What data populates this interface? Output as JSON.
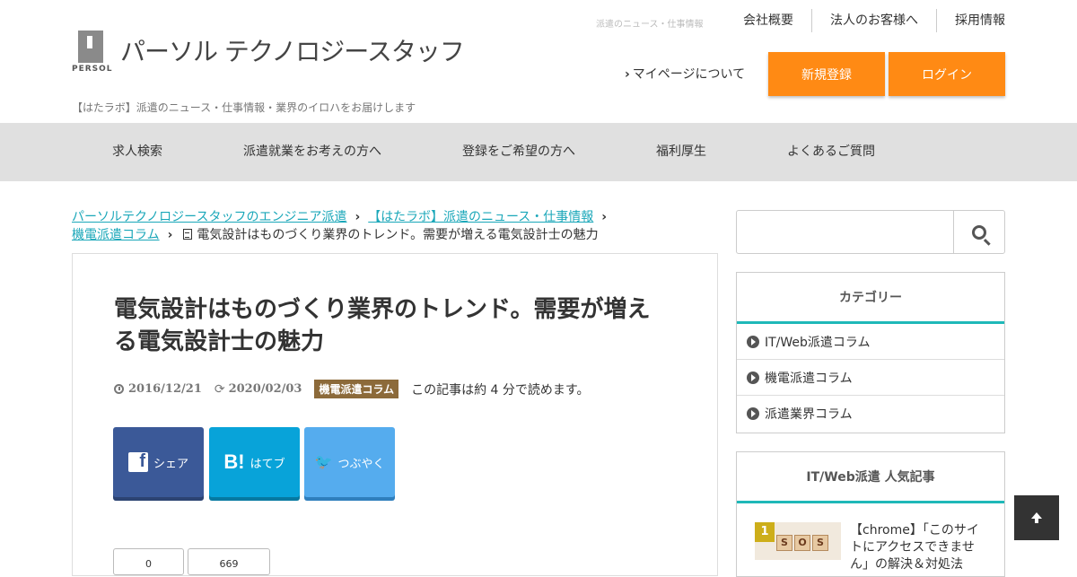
{
  "header": {
    "logo_text": "パーソル テクノロジースタッフ",
    "logo_sub": "PERSOL",
    "tagline": "【はたラボ】派遣のニュース・仕事情報・業界のイロハをお届けします",
    "top_small": "派遣のニュース・仕事情報",
    "top_links": [
      "会社概要",
      "法人のお客様へ",
      "採用情報"
    ],
    "mypage": "マイページについて",
    "register_button": "新規登録",
    "login_button": "ログイン",
    "accent_color": "#ff8a14"
  },
  "nav": {
    "items": [
      "求人検索",
      "派遣就業をお考えの方へ",
      "登録をご希望の方へ",
      "福利厚生",
      "よくあるご質問"
    ]
  },
  "breadcrumb": {
    "items": [
      "パーソルテクノロジースタッフのエンジニア派遣",
      "【はたラボ】派遣のニュース・仕事情報",
      "機電派遣コラム"
    ],
    "current": "電気設計はものづくり業界のトレンド。需要が増える電気設計士の魅力"
  },
  "article": {
    "title": "電気設計はものづくり業界のトレンド。需要が増える電気設計士の魅力",
    "published": "2016/12/21",
    "updated": "2020/02/03",
    "category": "機電派遣コラム",
    "read_time": "この記事は約 4 分で読めます。",
    "share": {
      "facebook": "シェア",
      "hatena": "はてブ",
      "twitter": "つぶやく"
    },
    "counts": [
      "0",
      "669"
    ]
  },
  "sidebar": {
    "search_placeholder": "",
    "category_title": "カテゴリー",
    "categories": [
      "IT/Web派遣コラム",
      "機電派遣コラム",
      "派遣業界コラム"
    ],
    "popular_title": "IT/Web派遣 人気記事",
    "popular": [
      {
        "rank": "1",
        "title": "【chrome】「このサイトにアクセスできません」の解決＆対処法"
      }
    ]
  }
}
